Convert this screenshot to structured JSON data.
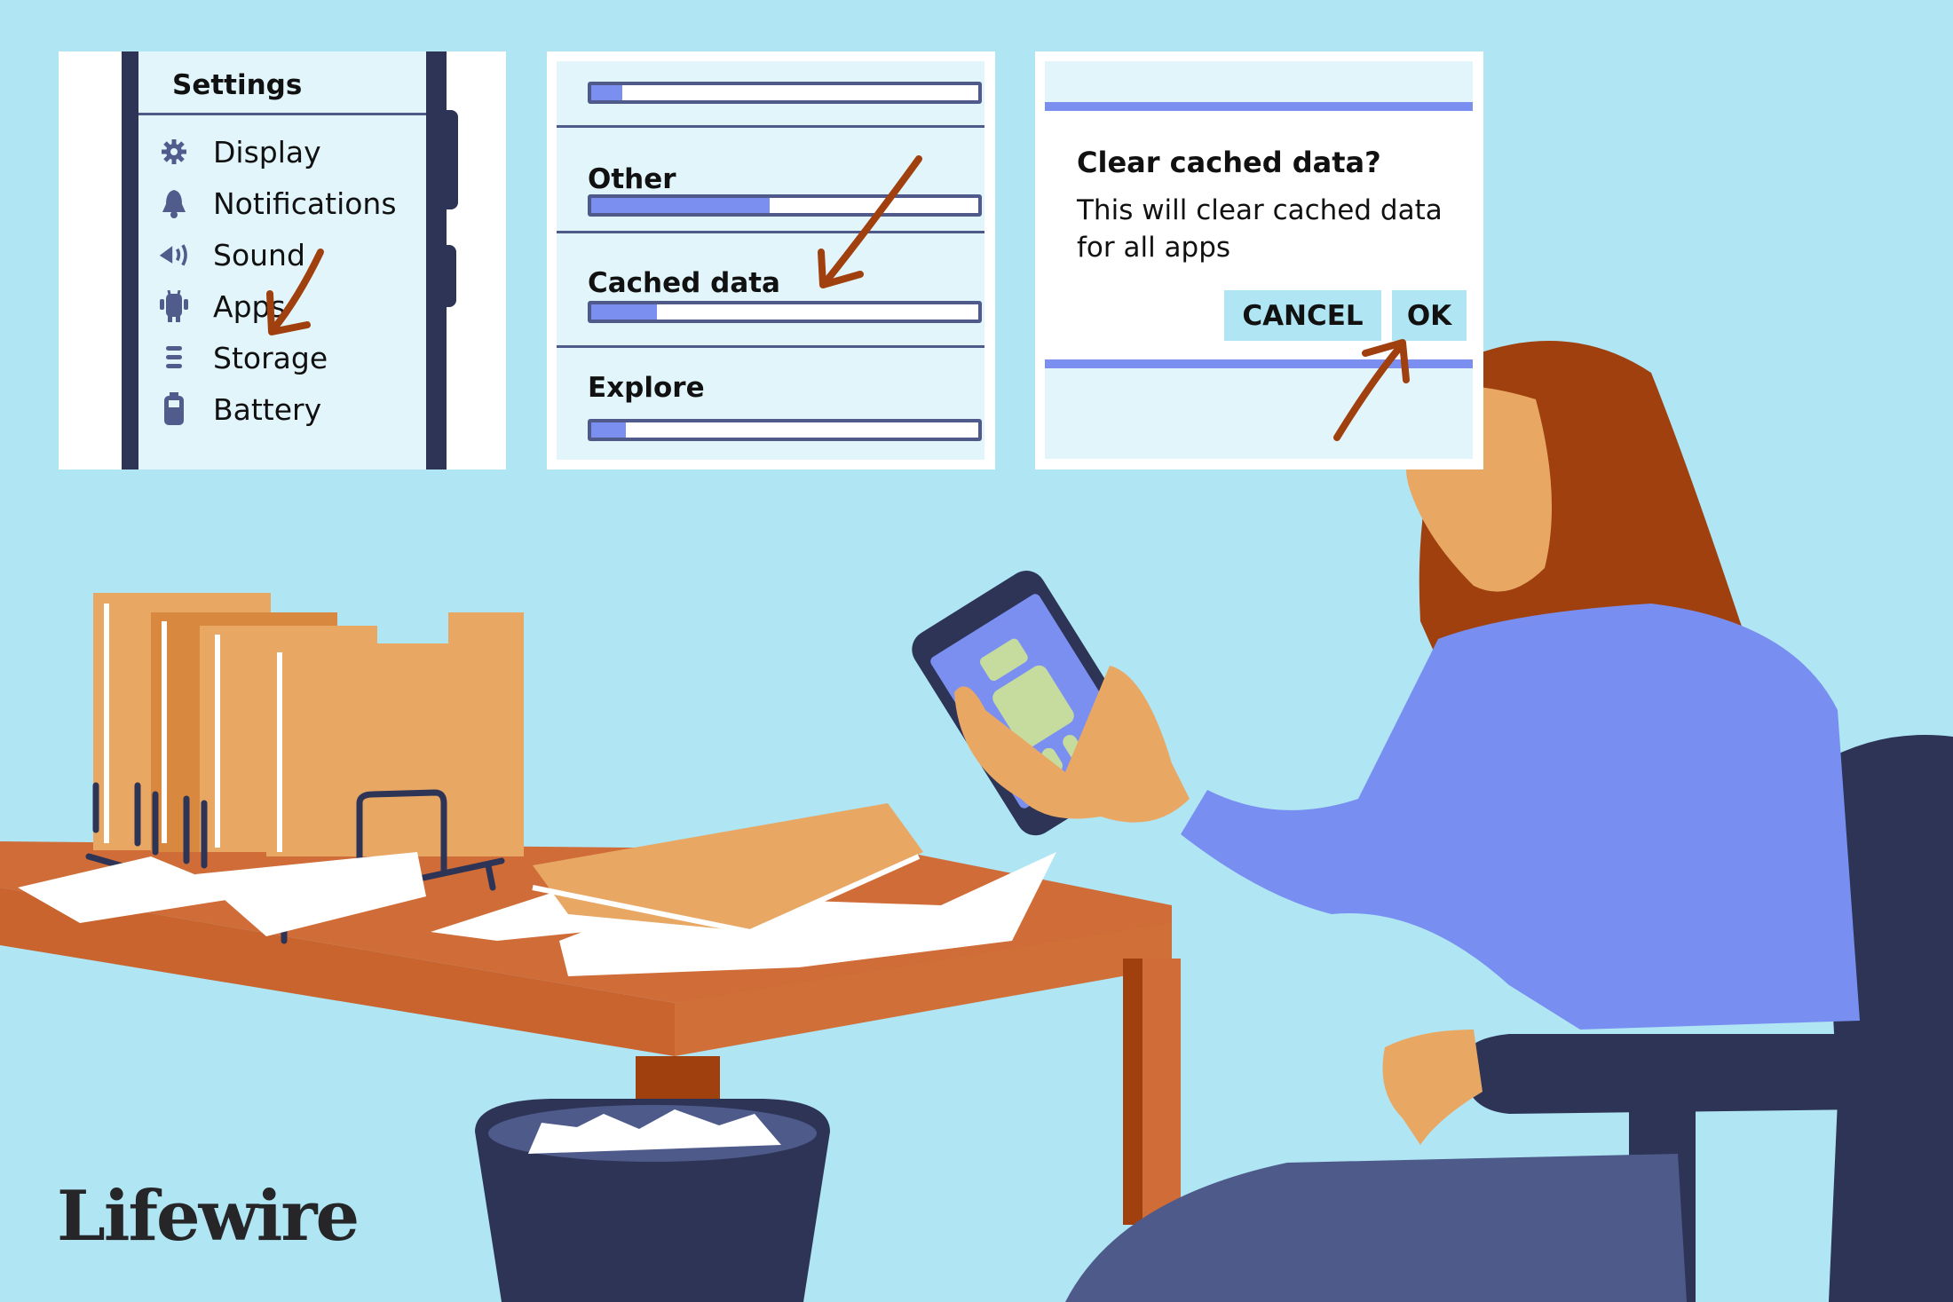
{
  "settings_panel": {
    "title": "Settings",
    "items": [
      {
        "label": "Display",
        "icon": "gear-icon"
      },
      {
        "label": "Notifications",
        "icon": "bell-icon"
      },
      {
        "label": "Sound",
        "icon": "speaker-icon"
      },
      {
        "label": "Apps",
        "icon": "android-icon"
      },
      {
        "label": "Storage",
        "icon": "storage-icon"
      },
      {
        "label": "Battery",
        "icon": "battery-icon"
      }
    ]
  },
  "storage_panel": {
    "rows": [
      {
        "label": "",
        "percent": 8
      },
      {
        "label": "Other",
        "percent": 46
      },
      {
        "label": "Cached data",
        "percent": 17
      },
      {
        "label": "Explore",
        "percent": 9
      }
    ]
  },
  "dialog_panel": {
    "title": "Clear cached data?",
    "message": "This will clear cached data for all apps",
    "cancel_label": "CANCEL",
    "ok_label": "OK"
  },
  "brand": {
    "logo": "Lifewire"
  },
  "colors": {
    "background": "#b0e5f4",
    "screen": "#e2f5fb",
    "accent": "#7b8ff1",
    "navy": "#2d3456",
    "arrow": "#a0400f",
    "desk": "#cf6c37",
    "folder": "#e8a864",
    "sweater": "#788ff1"
  }
}
